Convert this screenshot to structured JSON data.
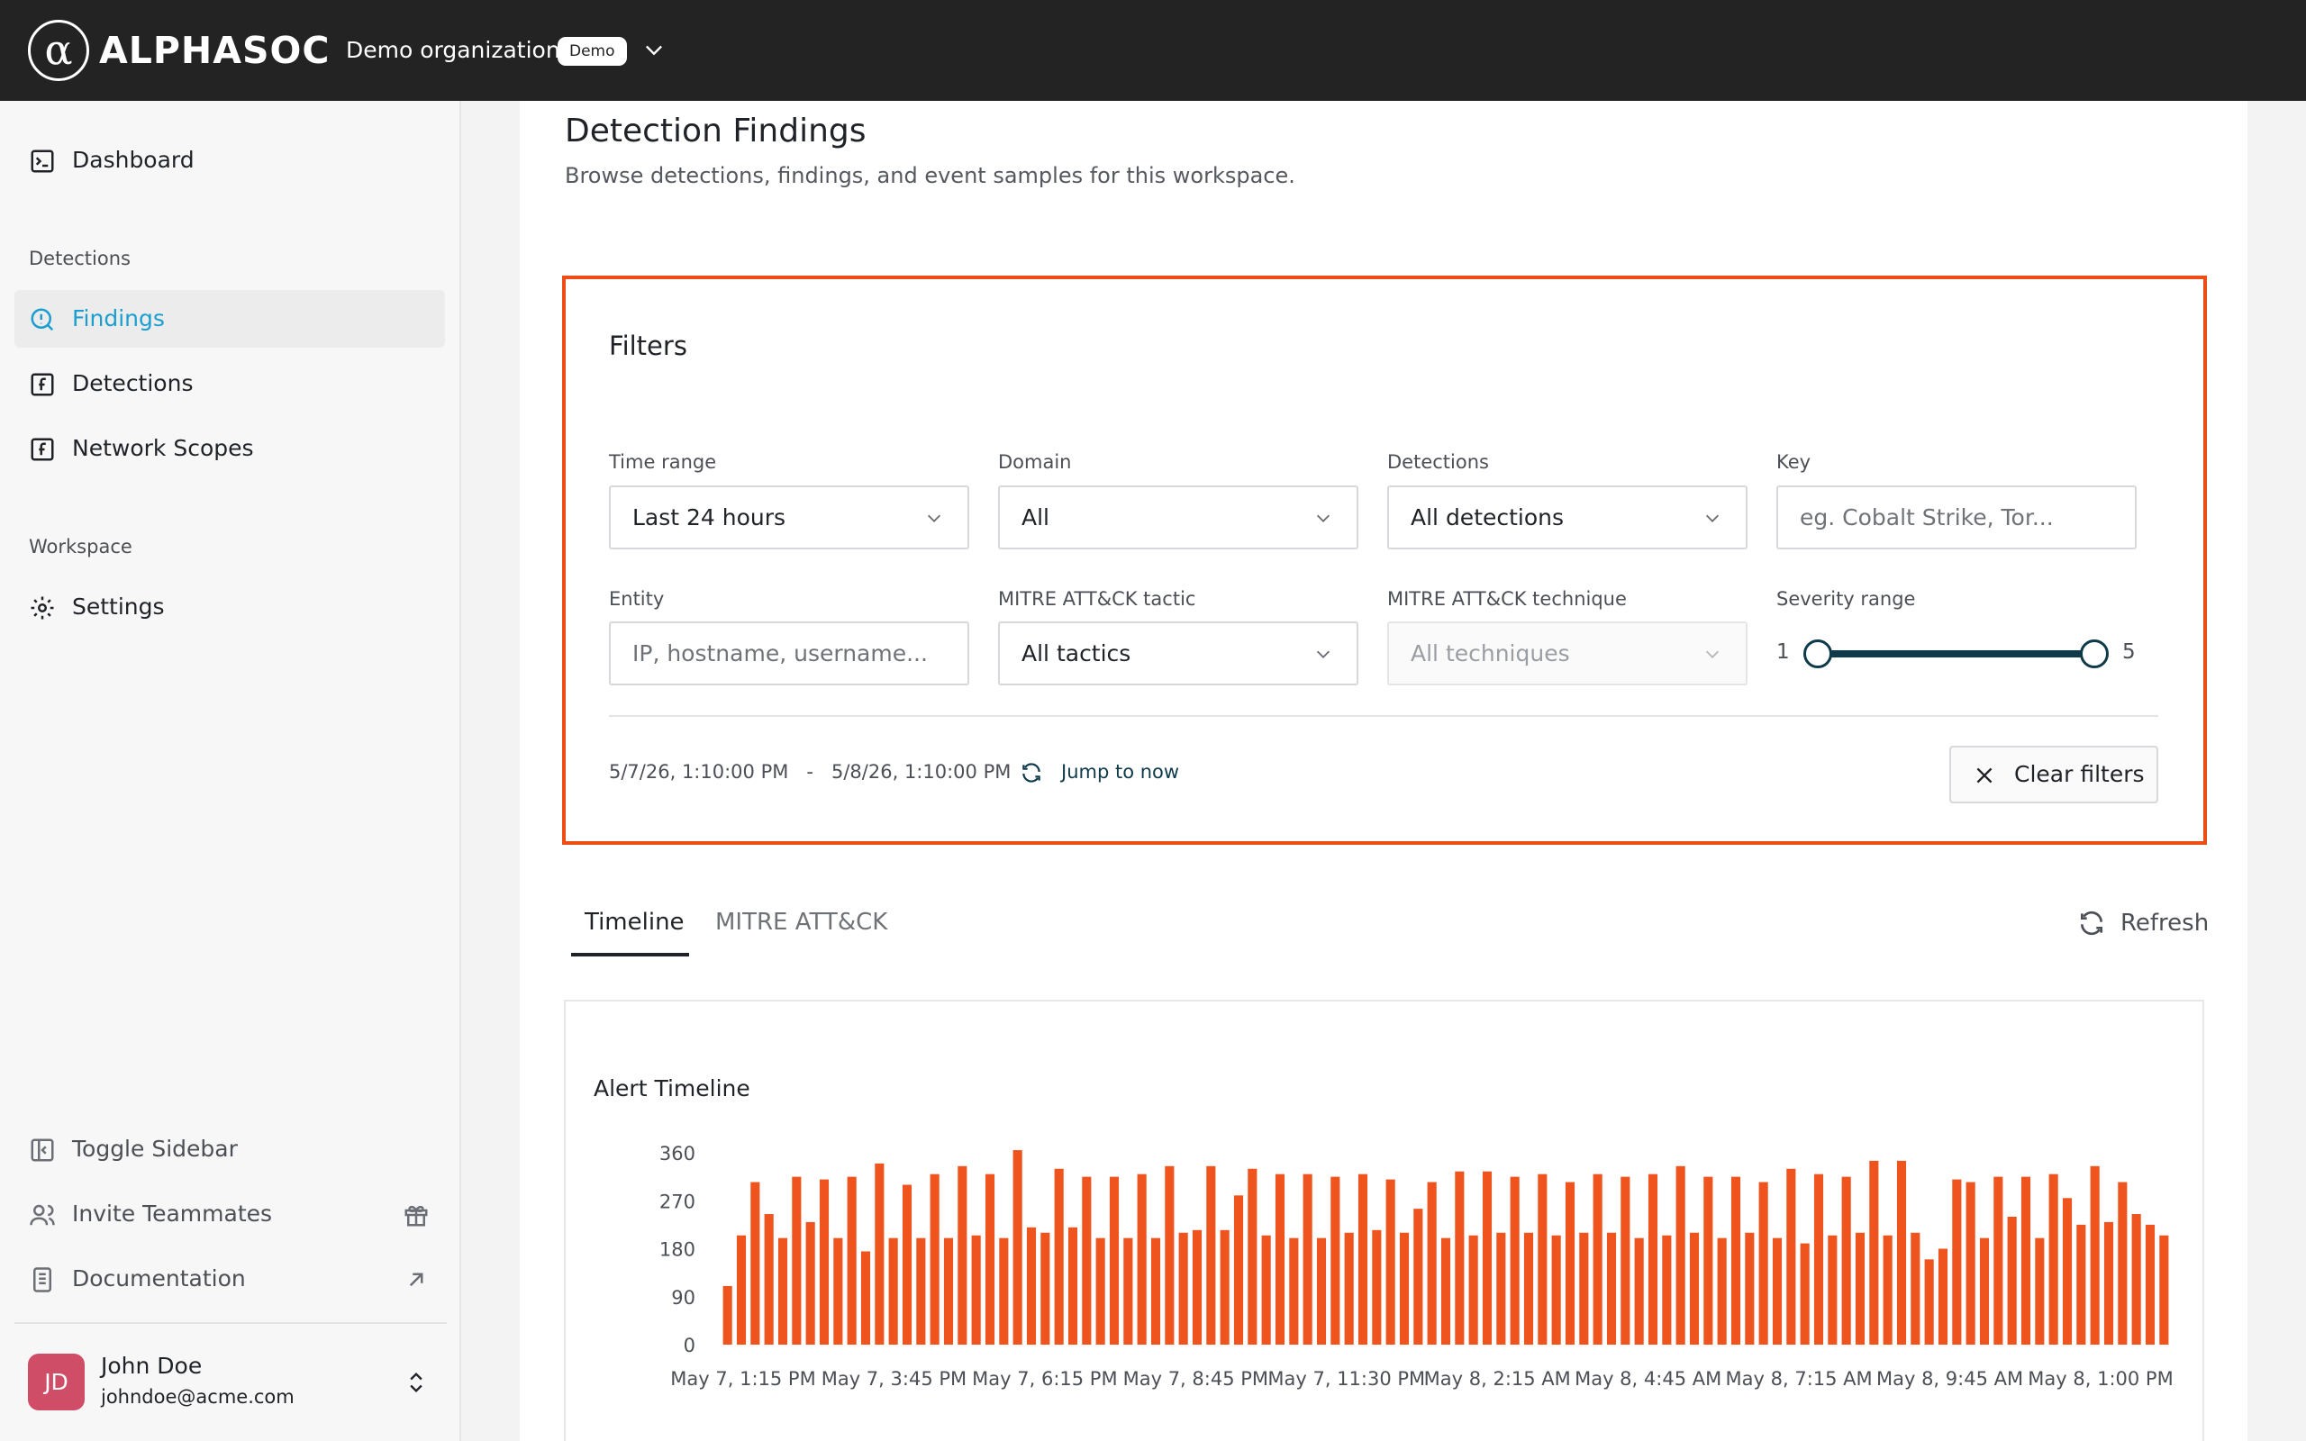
{
  "header": {
    "logo_glyph": "α",
    "logo_text": "ALPHASOC",
    "org_name": "Demo organization",
    "org_badge": "Demo"
  },
  "sidebar": {
    "items": [
      {
        "label": "Dashboard",
        "icon": "terminal-icon"
      },
      {
        "label": "Findings",
        "icon": "search-alert-icon",
        "active": true
      },
      {
        "label": "Detections",
        "icon": "function-icon"
      },
      {
        "label": "Network Scopes",
        "icon": "function-icon"
      },
      {
        "label": "Settings",
        "icon": "gear-icon"
      }
    ],
    "sections": {
      "detections": "Detections",
      "workspace": "Workspace"
    },
    "footer": {
      "toggle_sidebar": "Toggle Sidebar",
      "invite_teammates": "Invite Teammates",
      "documentation": "Documentation"
    },
    "user": {
      "initials": "JD",
      "name": "John Doe",
      "email": "johndoe@acme.com"
    }
  },
  "page": {
    "title": "Detection Findings",
    "subtitle": "Browse detections, findings, and event samples for this workspace."
  },
  "filters": {
    "title": "Filters",
    "time_range": {
      "label": "Time range",
      "value": "Last 24 hours"
    },
    "domain": {
      "label": "Domain",
      "value": "All"
    },
    "detections": {
      "label": "Detections",
      "value": "All detections"
    },
    "key": {
      "label": "Key",
      "placeholder": "eg. Cobalt Strike, Tor..."
    },
    "entity": {
      "label": "Entity",
      "placeholder": "IP, hostname, username..."
    },
    "tactic": {
      "label": "MITRE ATT&CK tactic",
      "value": "All tactics"
    },
    "technique": {
      "label": "MITRE ATT&CK technique",
      "value": "All techniques"
    },
    "severity": {
      "label": "Severity range",
      "min": "1",
      "max": "5",
      "low": 1,
      "high": 5
    },
    "date_from": "5/7/26, 1:10:00 PM",
    "date_sep": "-",
    "date_to": "5/8/26, 1:10:00 PM",
    "jump_to_now": "Jump to now",
    "clear_filters": "Clear filters"
  },
  "tabs": [
    {
      "label": "Timeline",
      "active": true
    },
    {
      "label": "MITRE ATT&CK",
      "active": false
    }
  ],
  "refresh_label": "Refresh",
  "colors": {
    "accent": "#ef4d16",
    "bar": "#f0541e",
    "active_nav": "#1a9fd0",
    "slider": "#0f3a4a"
  },
  "chart_data": {
    "type": "bar",
    "title": "Alert Timeline",
    "ylim": [
      0,
      360
    ],
    "yticks": [
      0,
      90,
      180,
      270,
      360
    ],
    "xtick_labels": [
      "May 7, 1:15 PM",
      "May 7, 3:45 PM",
      "May 7, 6:15 PM",
      "May 7, 8:45 PM",
      "May 7, 11:30 PM",
      "May 8, 2:15 AM",
      "May 8, 4:45 AM",
      "May 8, 7:15 AM",
      "May 8, 9:45 AM",
      "May 8, 1:00 PM"
    ],
    "values": [
      110,
      205,
      305,
      245,
      200,
      315,
      230,
      310,
      200,
      315,
      175,
      340,
      200,
      300,
      200,
      320,
      200,
      335,
      205,
      320,
      200,
      365,
      220,
      210,
      330,
      220,
      315,
      200,
      315,
      200,
      320,
      200,
      335,
      210,
      215,
      335,
      215,
      280,
      330,
      205,
      320,
      200,
      320,
      200,
      315,
      210,
      320,
      215,
      310,
      210,
      255,
      305,
      200,
      325,
      205,
      325,
      210,
      315,
      210,
      320,
      205,
      305,
      210,
      320,
      210,
      315,
      200,
      320,
      205,
      335,
      210,
      315,
      200,
      315,
      210,
      305,
      200,
      330,
      190,
      320,
      205,
      315,
      210,
      345,
      205,
      345,
      210,
      160,
      180,
      310,
      305,
      200,
      315,
      240,
      315,
      200,
      320,
      275,
      225,
      335,
      230,
      305,
      245,
      225,
      205
    ]
  }
}
